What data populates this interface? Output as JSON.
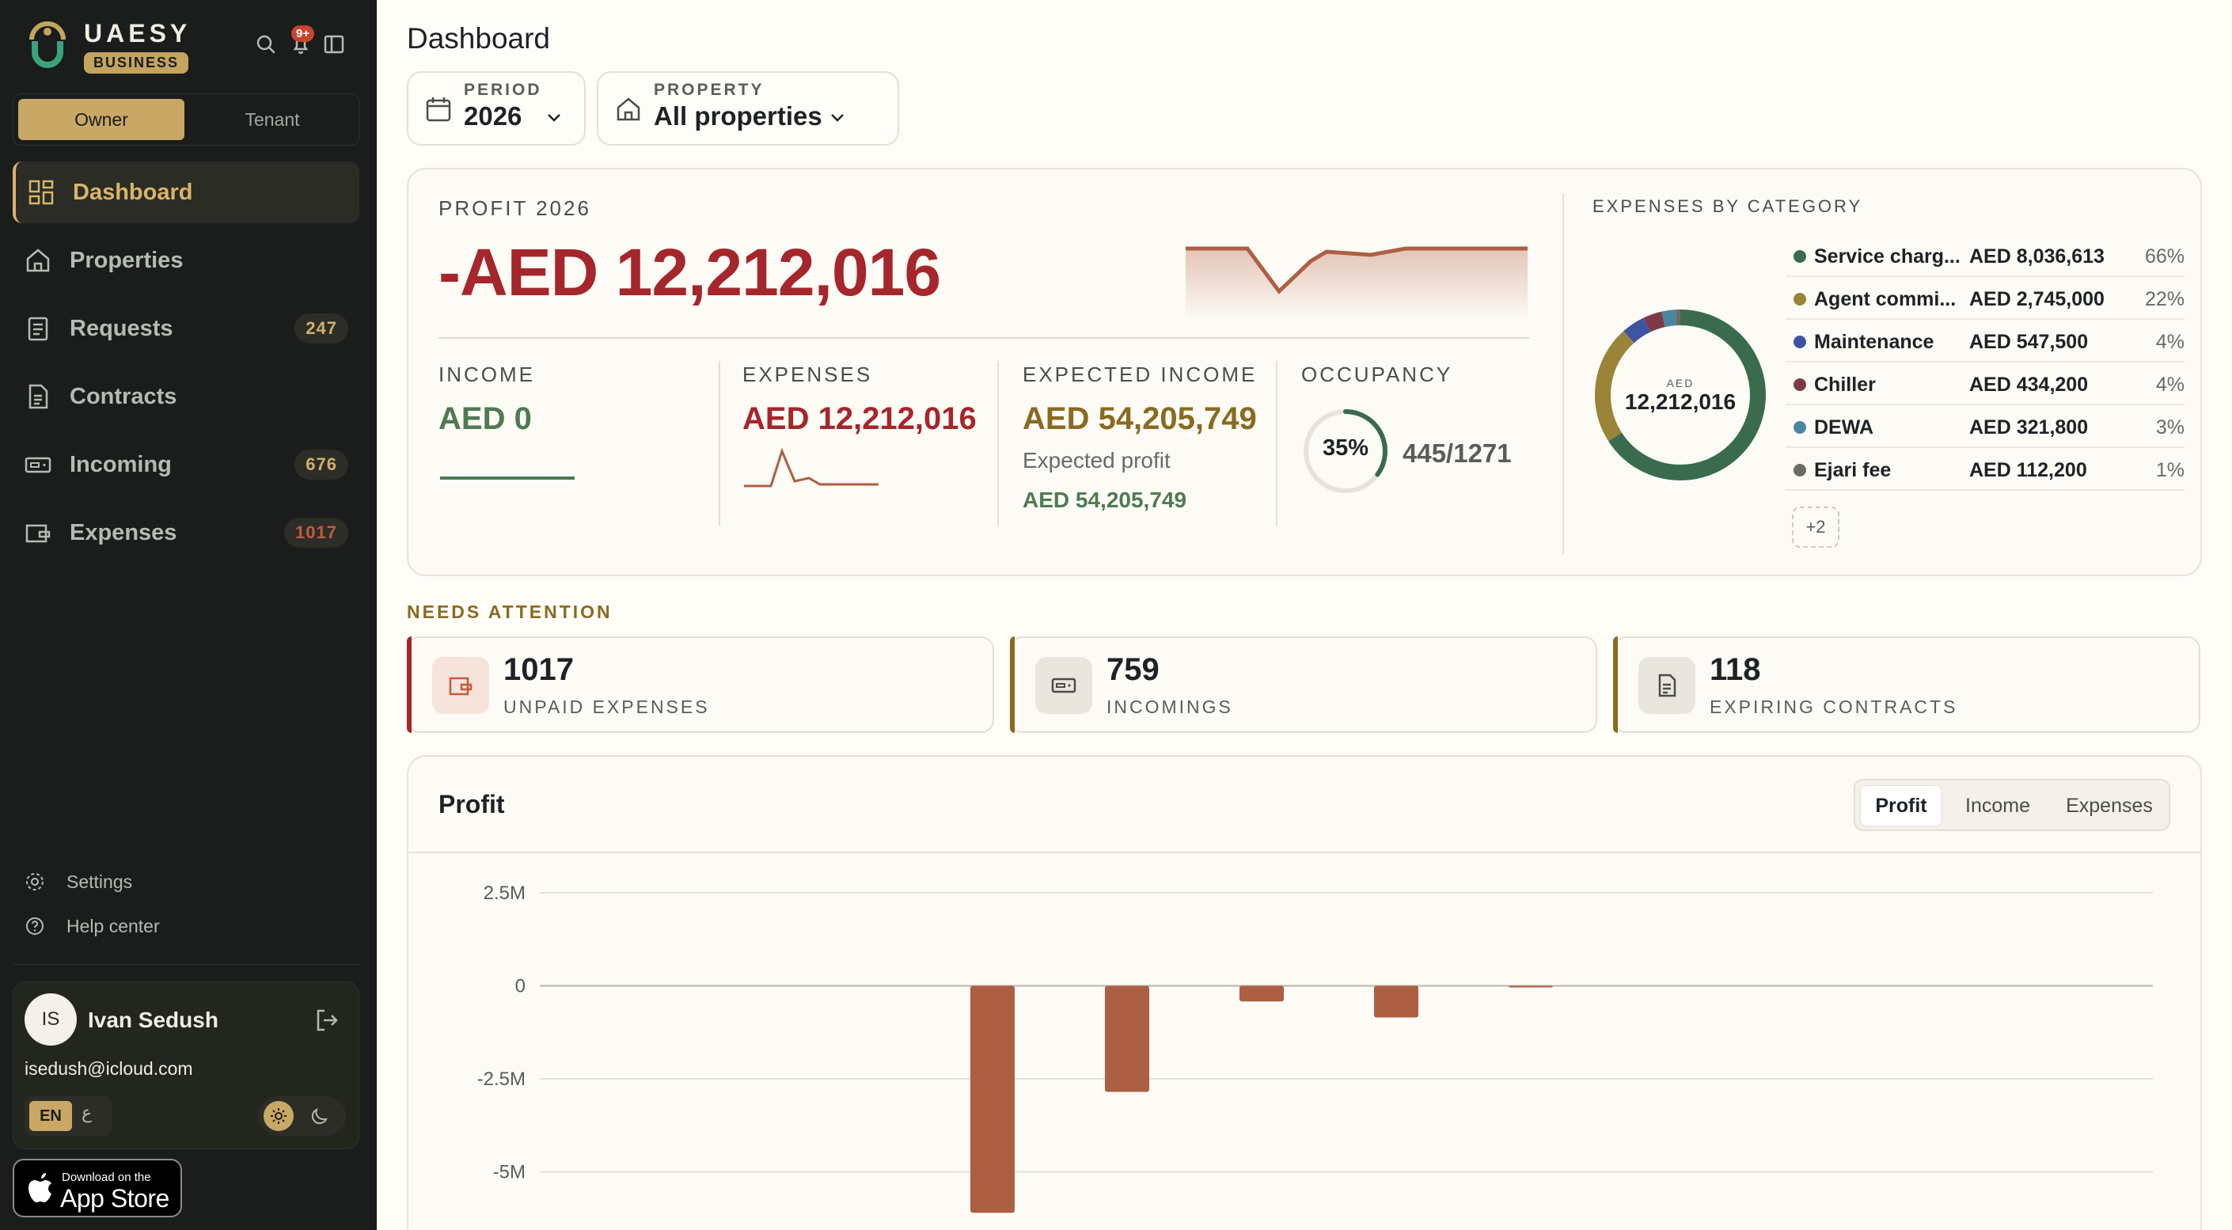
{
  "brand": {
    "name": "UAESY",
    "badge": "BUSINESS"
  },
  "notifications": {
    "badge": "9+"
  },
  "roles": {
    "owner": "Owner",
    "tenant": "Tenant"
  },
  "nav": {
    "dashboard": "Dashboard",
    "properties": "Properties",
    "requests": {
      "label": "Requests",
      "count": "247"
    },
    "contracts": "Contracts",
    "incoming": {
      "label": "Incoming",
      "count": "676"
    },
    "expenses": {
      "label": "Expenses",
      "count": "1017"
    }
  },
  "sub_nav": {
    "settings": "Settings",
    "help": "Help center"
  },
  "user": {
    "initials": "IS",
    "name": "Ivan Sedush",
    "email": "isedush@icloud.com"
  },
  "language": {
    "en": "EN",
    "ar": "ع"
  },
  "app_store": {
    "small": "Download on the",
    "big": "App Store"
  },
  "page": {
    "title": "Dashboard"
  },
  "filters": {
    "period": {
      "label": "PERIOD",
      "value": "2026"
    },
    "property": {
      "label": "PROPERTY",
      "value": "All properties"
    }
  },
  "summary": {
    "profit_label": "PROFIT",
    "profit_year": "2026",
    "profit_value": "-AED 12,212,016",
    "income": {
      "label": "INCOME",
      "value": "AED 0"
    },
    "expenses": {
      "label": "EXPENSES",
      "value": "AED 12,212,016"
    },
    "expected_income": {
      "label": "EXPECTED INCOME",
      "value": "AED 54,205,749",
      "profit_label": "Expected profit",
      "profit_value": "AED 54,205,749"
    },
    "occupancy": {
      "label": "OCCUPANCY",
      "percent": "35%",
      "fraction": 0.35,
      "count": "445/1271"
    }
  },
  "categories": {
    "label": "EXPENSES BY CATEGORY",
    "donut_caption": "AED",
    "donut_total": "12,212,016",
    "more": "+2",
    "items": [
      {
        "name": "Service charg...",
        "amount": "AED 8,036,613",
        "pct": "66%",
        "value": 8036613,
        "color": "#3a6b4f"
      },
      {
        "name": "Agent commi...",
        "amount": "AED 2,745,000",
        "pct": "22%",
        "value": 2745000,
        "color": "#9b8337"
      },
      {
        "name": "Maintenance",
        "amount": "AED 547,500",
        "pct": "4%",
        "value": 547500,
        "color": "#3d55a0"
      },
      {
        "name": "Chiller",
        "amount": "AED 434,200",
        "pct": "4%",
        "value": 434200,
        "color": "#7e3a48"
      },
      {
        "name": "DEWA",
        "amount": "AED 321,800",
        "pct": "3%",
        "value": 321800,
        "color": "#4a86a1"
      },
      {
        "name": "Ejari fee",
        "amount": "AED 112,200",
        "pct": "1%",
        "value": 112200,
        "color": "#6f6b62"
      }
    ]
  },
  "attention": {
    "label": "NEEDS ATTENTION",
    "unpaid": {
      "count": "1017",
      "label": "UNPAID EXPENSES"
    },
    "incomings": {
      "count": "759",
      "label": "INCOMINGS"
    },
    "contracts": {
      "count": "118",
      "label": "EXPIRING CONTRACTS"
    }
  },
  "profit_chart_card": {
    "title": "Profit",
    "tabs": {
      "profit": "Profit",
      "income": "Income",
      "expenses": "Expenses"
    }
  },
  "colors": {
    "negative": "#a5262b",
    "positive": "#4f7a52",
    "gold": "#8a6a21",
    "bar": "#ad5f44"
  },
  "chart_data": {
    "type": "bar",
    "y_ticks": [
      "2.5M",
      "0",
      "-2.5M",
      "-5M"
    ],
    "tick_values": [
      2500000,
      0,
      -2500000,
      -5000000
    ],
    "ylim": [
      -6400000,
      3500000
    ],
    "categories": [
      "",
      "",
      "",
      "",
      "",
      "",
      "",
      "",
      "",
      "",
      "",
      ""
    ],
    "values": [
      0,
      0,
      0,
      -6100000,
      -2850000,
      -420000,
      -850000,
      -30000,
      0,
      0,
      0,
      0
    ]
  }
}
